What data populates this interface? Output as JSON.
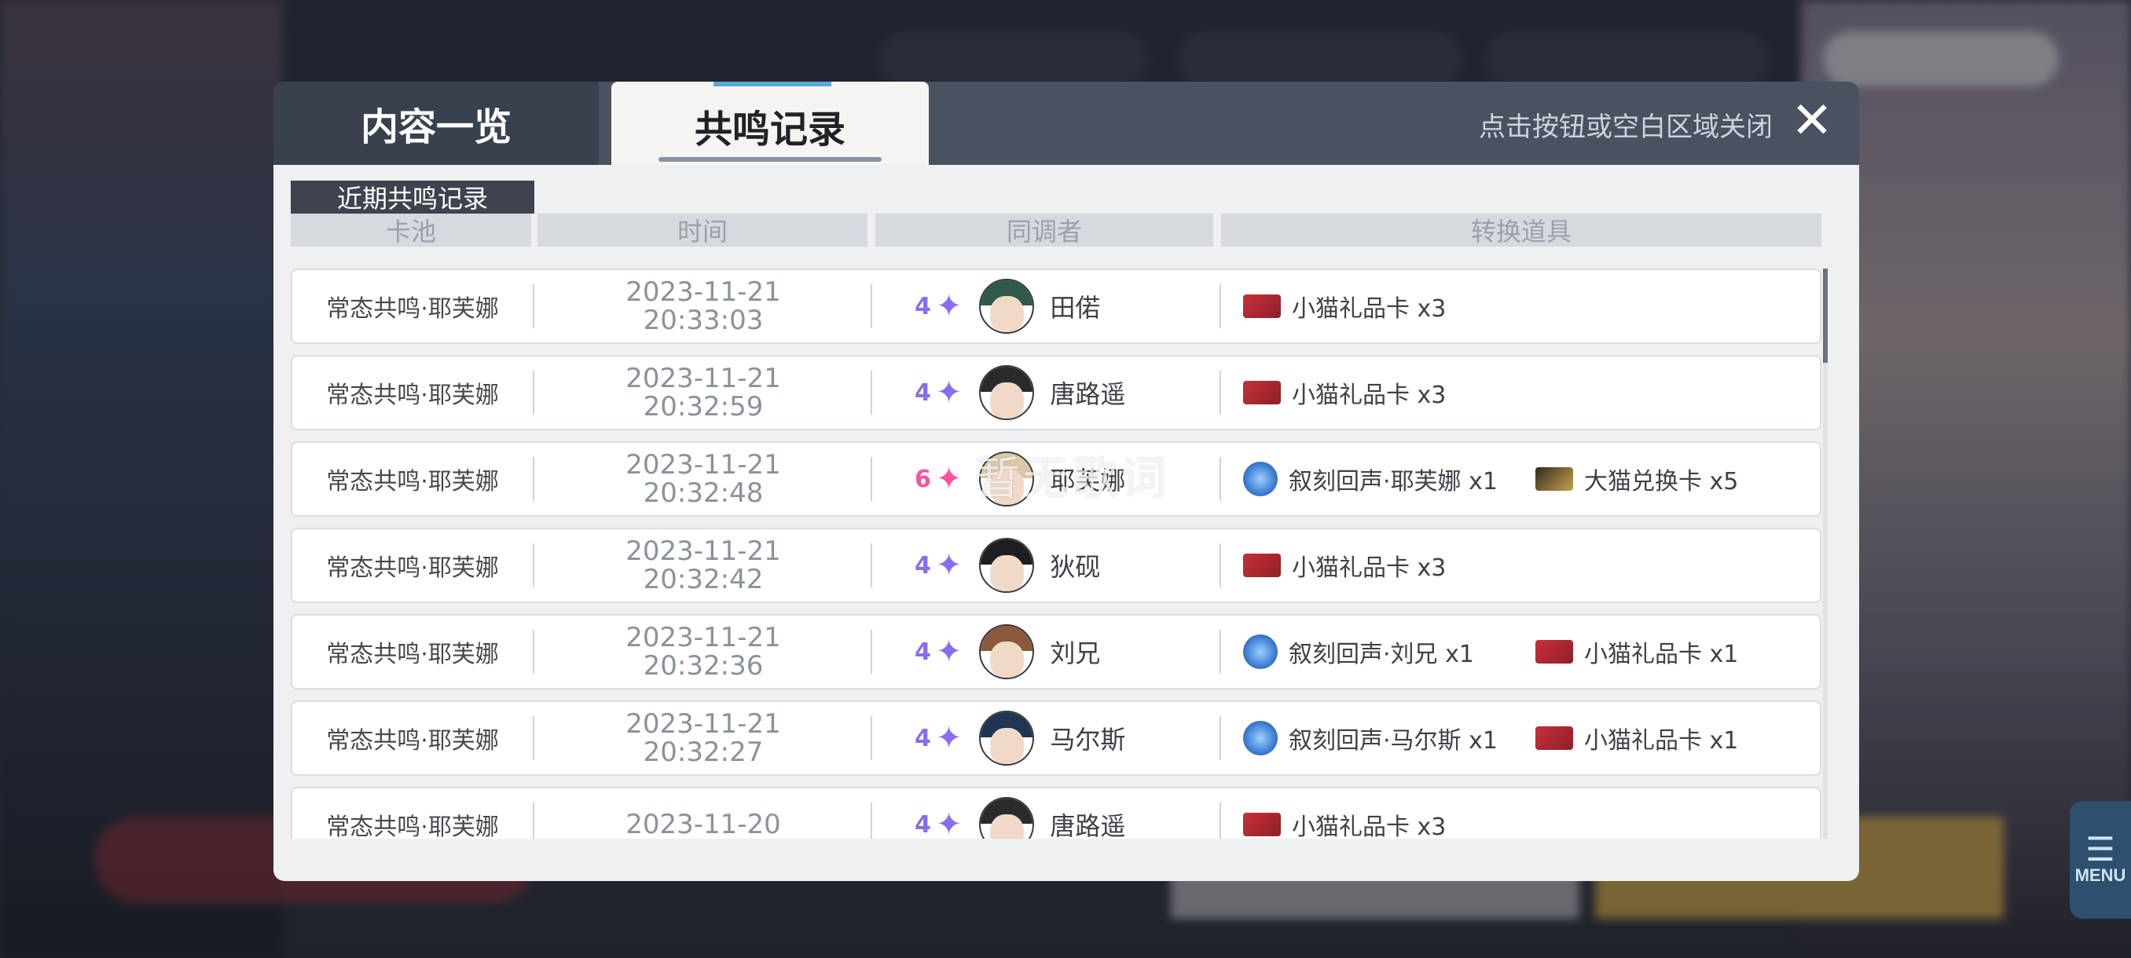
{
  "tabs": [
    {
      "label": "内容一览"
    },
    {
      "label": "共鸣记录"
    }
  ],
  "close_hint": "点击按钮或空白区域关闭",
  "section_label": "近期共鸣记录",
  "columns": [
    "卡池",
    "时间",
    "同调者",
    "转换道具"
  ],
  "menu_label": "MENU",
  "watermark": "暂无歌词",
  "colors": {
    "star4": "#8a6cf0",
    "star6": "#ff4fa3",
    "header": "#4a5261"
  },
  "records": [
    {
      "pool": "常态共鸣·耶芙娜",
      "date": "2023-11-21",
      "time": "20:33:03",
      "rarity": "4",
      "character": "田偌",
      "items": [
        {
          "icon": "red-gift-card-icon",
          "text": "小猫礼品卡 x3"
        }
      ]
    },
    {
      "pool": "常态共鸣·耶芙娜",
      "date": "2023-11-21",
      "time": "20:32:59",
      "rarity": "4",
      "character": "唐路遥",
      "items": [
        {
          "icon": "red-gift-card-icon",
          "text": "小猫礼品卡 x3"
        }
      ]
    },
    {
      "pool": "常态共鸣·耶芙娜",
      "date": "2023-11-21",
      "time": "20:32:48",
      "rarity": "6",
      "character": "耶芙娜",
      "items": [
        {
          "icon": "echo-orb-icon",
          "text": "叙刻回声·耶芙娜 x1"
        },
        {
          "icon": "gold-exchange-card-icon",
          "text": "大猫兑换卡 x5"
        }
      ]
    },
    {
      "pool": "常态共鸣·耶芙娜",
      "date": "2023-11-21",
      "time": "20:32:42",
      "rarity": "4",
      "character": "狄砚",
      "items": [
        {
          "icon": "red-gift-card-icon",
          "text": "小猫礼品卡 x3"
        }
      ]
    },
    {
      "pool": "常态共鸣·耶芙娜",
      "date": "2023-11-21",
      "time": "20:32:36",
      "rarity": "4",
      "character": "刘兄",
      "items": [
        {
          "icon": "echo-orb-icon",
          "text": "叙刻回声·刘兄 x1"
        },
        {
          "icon": "red-gift-card-icon",
          "text": "小猫礼品卡 x1"
        }
      ]
    },
    {
      "pool": "常态共鸣·耶芙娜",
      "date": "2023-11-21",
      "time": "20:32:27",
      "rarity": "4",
      "character": "马尔斯",
      "items": [
        {
          "icon": "echo-orb-icon",
          "text": "叙刻回声·马尔斯 x1"
        },
        {
          "icon": "red-gift-card-icon",
          "text": "小猫礼品卡 x1"
        }
      ]
    },
    {
      "pool": "常态共鸣·耶芙娜",
      "date": "2023-11-20",
      "time": "",
      "rarity": "4",
      "character": "唐路遥",
      "items": [
        {
          "icon": "red-gift-card-icon",
          "text": "小猫礼品卡 x3"
        }
      ]
    }
  ]
}
